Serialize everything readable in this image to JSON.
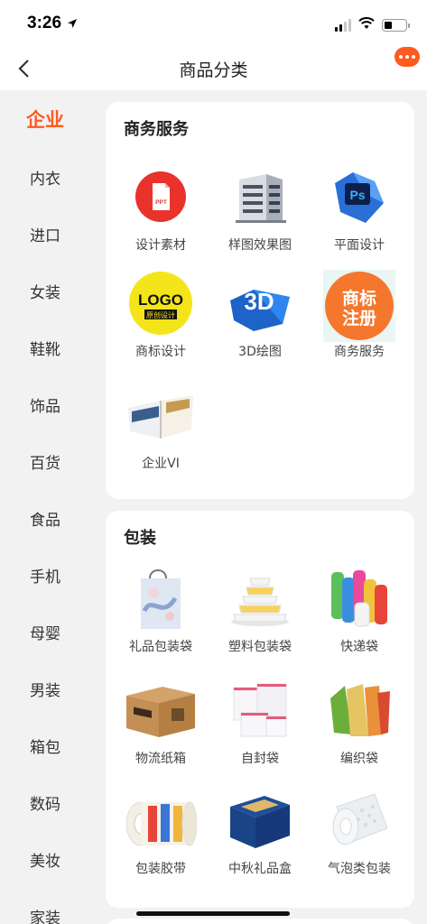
{
  "status": {
    "time": "3:26"
  },
  "nav": {
    "title": "商品分类"
  },
  "sidebar": {
    "items": [
      {
        "label": "企业"
      },
      {
        "label": "内衣"
      },
      {
        "label": "进口"
      },
      {
        "label": "女装"
      },
      {
        "label": "鞋靴"
      },
      {
        "label": "饰品"
      },
      {
        "label": "百货"
      },
      {
        "label": "食品"
      },
      {
        "label": "手机"
      },
      {
        "label": "母婴"
      },
      {
        "label": "男装"
      },
      {
        "label": "箱包"
      },
      {
        "label": "数码"
      },
      {
        "label": "美妆"
      },
      {
        "label": "家装"
      }
    ]
  },
  "sections": [
    {
      "title": "商务服务",
      "items": [
        {
          "label": "设计素材"
        },
        {
          "label": "样图效果图"
        },
        {
          "label": "平面设计"
        },
        {
          "label": "商标设计"
        },
        {
          "label": "3D绘图"
        },
        {
          "label": "商务服务"
        },
        {
          "label": "企业VI"
        }
      ]
    },
    {
      "title": "包装",
      "items": [
        {
          "label": "礼品包装袋"
        },
        {
          "label": "塑料包装袋"
        },
        {
          "label": "快递袋"
        },
        {
          "label": "物流纸箱"
        },
        {
          "label": "自封袋"
        },
        {
          "label": "编织袋"
        },
        {
          "label": "包装胶带"
        },
        {
          "label": "中秋礼品盒"
        },
        {
          "label": "气泡类包装"
        }
      ]
    }
  ],
  "thumb_text": {
    "ppt": "PPT",
    "logo": "LOGO",
    "logo_sub": "原创设计",
    "threed": "3D",
    "trademark_1": "商标",
    "trademark_2": "注册",
    "ps": "Ps"
  },
  "colors": {
    "accent": "#ff5a1f"
  }
}
